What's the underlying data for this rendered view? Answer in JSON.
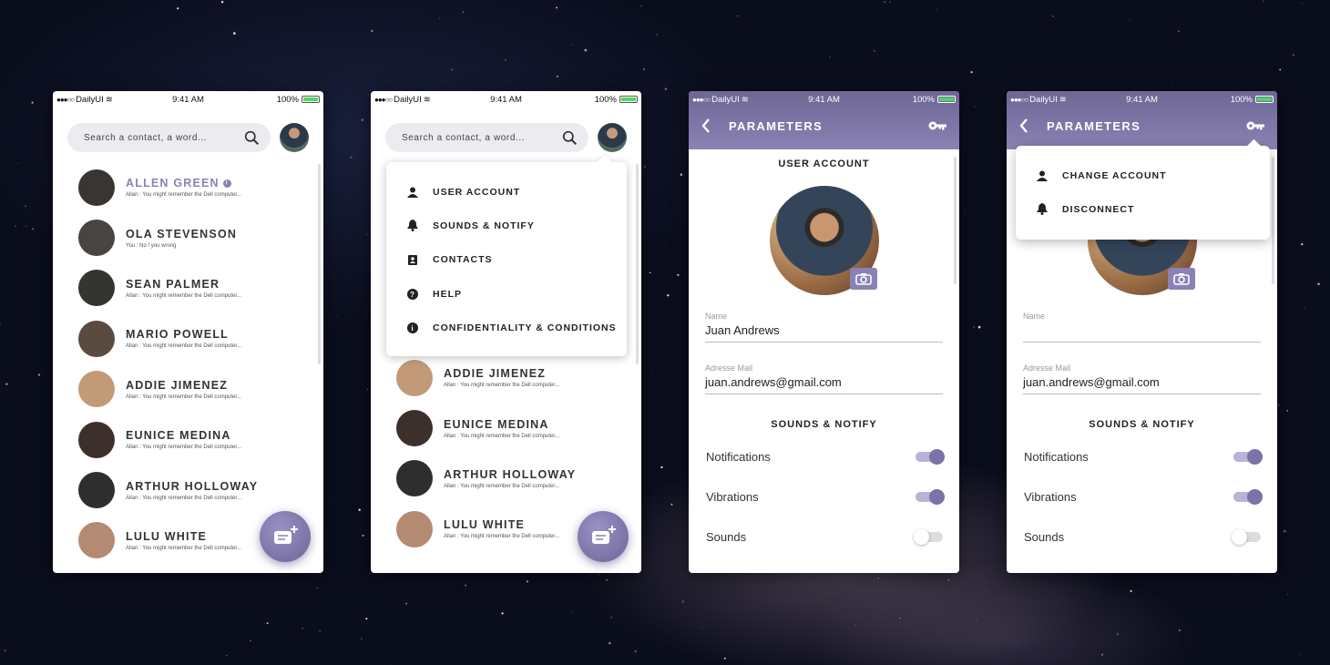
{
  "status": {
    "carrier": "DailyUI",
    "time": "9:41 AM",
    "battery": "100%"
  },
  "search": {
    "placeholder": "Search a contact, a word..."
  },
  "contacts": [
    {
      "name": "ALLEN GREEN",
      "msg": "Allan : You might remember the Dell computer...",
      "color": "#3a3530"
    },
    {
      "name": "OLA STEVENSON",
      "msg": "You : No ! you wrong",
      "color": "#4a4440"
    },
    {
      "name": "SEAN PALMER",
      "msg": "Allan : You might remember the Dell computer...",
      "color": "#35342e"
    },
    {
      "name": "MARIO POWELL",
      "msg": "Allan : You might remember the Dell computer...",
      "color": "#5a4a40"
    },
    {
      "name": "ADDIE JIMENEZ",
      "msg": "Allan : You might remember the Dell computer...",
      "color": "#c29a78"
    },
    {
      "name": "EUNICE MEDINA",
      "msg": "Allan : You might remember the Dell computer...",
      "color": "#3d302c"
    },
    {
      "name": "ARTHUR HOLLOWAY",
      "msg": "Allan : You might remember the Dell computer...",
      "color": "#2e2e2e"
    },
    {
      "name": "LULU WHITE",
      "msg": "Allan : You might remember the Dell computer...",
      "color": "#b48a72"
    }
  ],
  "menu": [
    {
      "label": "USER ACCOUNT",
      "icon": "person-icon"
    },
    {
      "label": "SOUNDS & NOTIFY",
      "icon": "bell-icon"
    },
    {
      "label": "CONTACTS",
      "icon": "contacts-icon"
    },
    {
      "label": "HELP",
      "icon": "help-icon"
    },
    {
      "label": "CONFIDENTIALITY & CONDITIONS",
      "icon": "info-icon"
    }
  ],
  "params": {
    "title": "PARAMETERS",
    "user_account": "USER ACCOUNT",
    "name_label": "Name",
    "name_value": "Juan Andrews",
    "mail_label": "Adresse Mail",
    "mail_value": "juan.andrews@gmail.com",
    "sounds_title": "SOUNDS & NOTIFY",
    "toggles": [
      {
        "label": "Notifications",
        "on": true
      },
      {
        "label": "Vibrations",
        "on": true
      },
      {
        "label": "Sounds",
        "on": false
      }
    ]
  },
  "account_menu": [
    {
      "label": "CHANGE ACCOUNT",
      "icon": "person-icon"
    },
    {
      "label": "DISCONNECT",
      "icon": "bell-icon"
    }
  ],
  "colors": {
    "accent": "#8a82b4",
    "header": "#6e6694"
  }
}
